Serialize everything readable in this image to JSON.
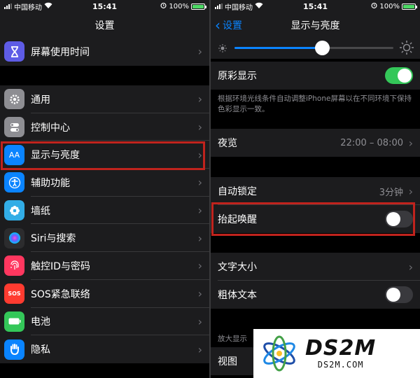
{
  "status_bar": {
    "carrier": "中国移动",
    "time": "15:41",
    "battery": "100%"
  },
  "left": {
    "title": "设置",
    "items": [
      {
        "label": "屏幕使用时间",
        "icon": "hourglass-icon",
        "color": "#5e5ce6"
      },
      {
        "label": "通用",
        "icon": "gear-icon",
        "color": "#8e8e93"
      },
      {
        "label": "控制中心",
        "icon": "toggles-icon",
        "color": "#8e8e93"
      },
      {
        "label": "显示与亮度",
        "icon": "text-size-icon",
        "color": "#0a84ff",
        "icon_text": "AA"
      },
      {
        "label": "辅助功能",
        "icon": "accessibility-icon",
        "color": "#0a84ff"
      },
      {
        "label": "墙纸",
        "icon": "flower-icon",
        "color": "#32ade6"
      },
      {
        "label": "Siri与搜索",
        "icon": "siri-icon",
        "color": "#2c2c2e"
      },
      {
        "label": "触控ID与密码",
        "icon": "fingerprint-icon",
        "color": "#ff375f"
      },
      {
        "label": "SOS紧急联络",
        "icon": "sos-icon",
        "color": "#ff3b30",
        "icon_text": "SOS"
      },
      {
        "label": "电池",
        "icon": "battery-icon",
        "color": "#34c759"
      },
      {
        "label": "隐私",
        "icon": "hand-icon",
        "color": "#0a84ff"
      }
    ]
  },
  "right": {
    "back_label": "设置",
    "title": "显示与亮度",
    "brightness_level": 0.55,
    "true_tone": {
      "label": "原彩显示",
      "on": true
    },
    "true_tone_note": "根据环境光线条件自动调整iPhone屏幕以在不同环境下保持色彩显示一致。",
    "night_shift": {
      "label": "夜览",
      "value": "22:00 – 08:00"
    },
    "auto_lock": {
      "label": "自动锁定",
      "value": "3分钟"
    },
    "raise_to_wake": {
      "label": "抬起唤醒",
      "on": false
    },
    "text_size": {
      "label": "文字大小"
    },
    "bold_text": {
      "label": "粗体文本",
      "on": false
    },
    "zoom_caption": "放大显示",
    "view": {
      "label": "视图"
    }
  },
  "watermark": {
    "big": "DS2M",
    "small": "DS2M.COM"
  },
  "colors": {
    "highlight": "#c0231d",
    "accent": "#0a84ff",
    "toggle_on": "#34c759"
  }
}
